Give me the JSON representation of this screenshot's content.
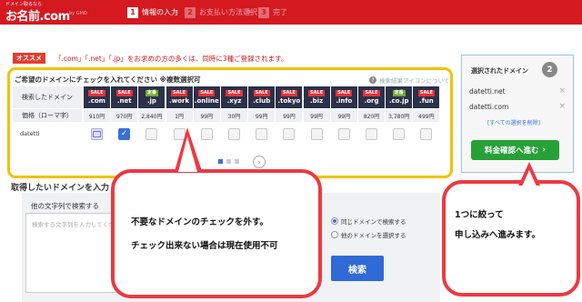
{
  "header": {
    "logo_tagline": "ドメイン取るなら",
    "logo": "お名前.com",
    "logo_sub": "by GMO",
    "steps": [
      {
        "num": "1",
        "label": "情報の入力"
      },
      {
        "num": "2",
        "label": "お支払い方法選択"
      },
      {
        "num": "3",
        "label": "完了"
      }
    ]
  },
  "promo": {
    "badge": "オススメ",
    "text": "「.com」「.net」「.jp」をお求めの方の多くは、同時に3種ご登録されます。"
  },
  "table": {
    "title": "ご希望のドメインにチェックを入れてください ※複数選択可",
    "help_link": "検索結果アイコンについて",
    "header_label": "検索したドメイン",
    "price_label": "価格（ローマ字）",
    "query": "datetti",
    "tlds": [
      {
        "badge": "SALE",
        "badge_type": "sale",
        "name": ".com",
        "price": "910円",
        "state": "taken"
      },
      {
        "badge": "SALE",
        "badge_type": "sale",
        "name": ".net",
        "price": "970円",
        "state": "checked"
      },
      {
        "badge": "定番",
        "badge_type": "teiban",
        "name": ".jp",
        "price": "2,840円",
        "state": "empty"
      },
      {
        "badge": "SALE",
        "badge_type": "sale",
        "name": ".work",
        "price": "1円",
        "state": "empty"
      },
      {
        "badge": "SALE",
        "badge_type": "sale",
        "name": ".online",
        "price": "99円",
        "state": "empty"
      },
      {
        "badge": "SALE",
        "badge_type": "sale",
        "name": ".xyz",
        "price": "30円",
        "state": "empty"
      },
      {
        "badge": "SALE",
        "badge_type": "sale",
        "name": ".club",
        "price": "99円",
        "state": "empty"
      },
      {
        "badge": "SALE",
        "badge_type": "sale",
        "name": ".tokyo",
        "price": "99円",
        "state": "empty"
      },
      {
        "badge": "SALE",
        "badge_type": "sale",
        "name": ".biz",
        "price": "99円",
        "state": "empty"
      },
      {
        "badge": "SALE",
        "badge_type": "sale",
        "name": ".info",
        "price": "99円",
        "state": "empty"
      },
      {
        "badge": "SALE",
        "badge_type": "sale",
        "name": ".org",
        "price": "820円",
        "state": "empty"
      },
      {
        "badge": "定番",
        "badge_type": "teiban",
        "name": ".co.jp",
        "price": "3,780円",
        "state": "empty"
      },
      {
        "badge": "SALE",
        "badge_type": "sale",
        "name": ".fun",
        "price": "499円",
        "state": "empty"
      }
    ],
    "next_arrow": "›"
  },
  "selected": {
    "title": "選択されたドメイン",
    "count": "2",
    "items": [
      "datetti.net",
      "datetti.com"
    ],
    "remove_icon": "×",
    "clear_all": "[すべての選択を削除]",
    "proceed_button": "料金確認へ進む",
    "proceed_arrow": "›"
  },
  "search": {
    "section_title": "取得したいドメインを入力",
    "label": "他の文字列で検索する",
    "placeholder": "検索する文字列を入力してください",
    "radio_same": "同じドメインで検索する",
    "radio_other": "他のドメインを選択する",
    "search_button": "検索"
  },
  "annotations": {
    "callout1_line1": "不要なドメインのチェックを外す。",
    "callout1_line2": "チェック出来ない場合は現在使用不可",
    "callout2_line1": "1つに絞って",
    "callout2_line2": "申し込みへ進みます。"
  },
  "colors": {
    "brand_red": "#d41920",
    "panel_highlight": "#f2c200",
    "tld_header": "#2b3148",
    "sale_badge": "#e8303a",
    "teiban_badge": "#6fa92c",
    "proceed_green": "#27a137",
    "search_blue": "#2f6ad6",
    "callout_red": "#ec3943"
  }
}
